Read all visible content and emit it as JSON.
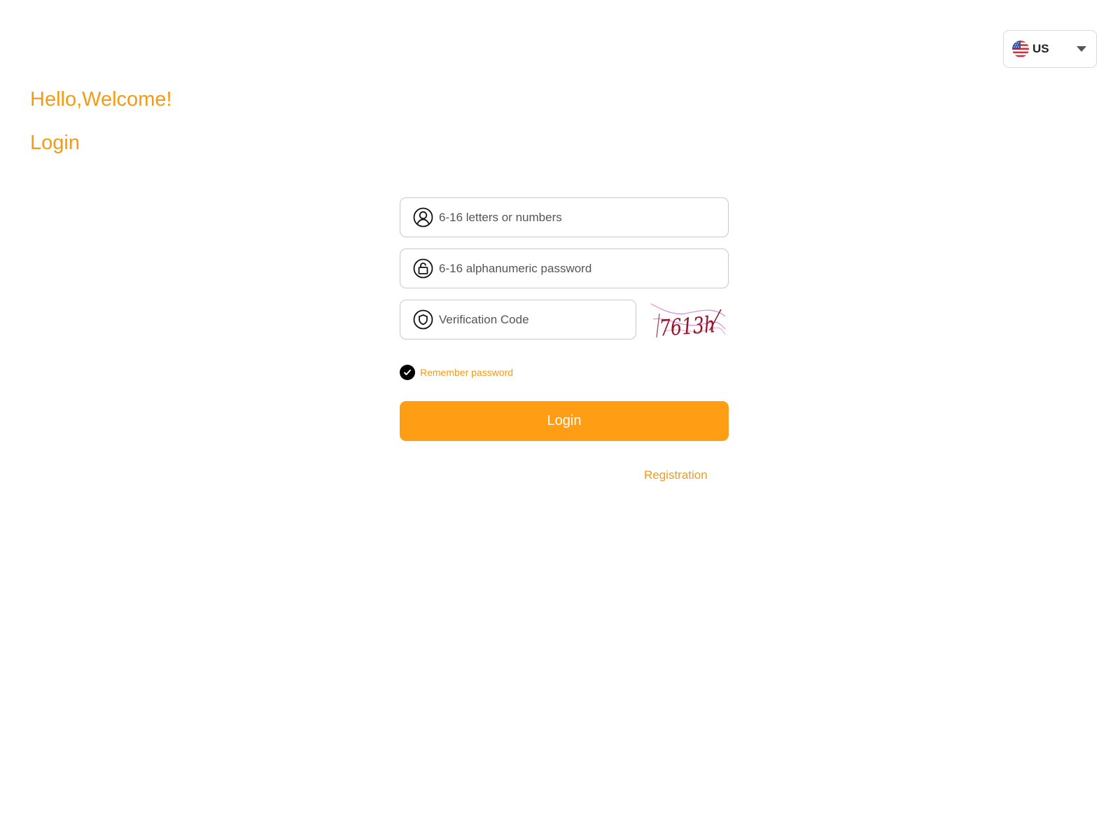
{
  "language": {
    "selected": "US",
    "flag_icon": "us-flag-icon"
  },
  "header": {
    "greeting": "Hello,Welcome!",
    "title": "Login"
  },
  "form": {
    "username": {
      "placeholder": "6-16 letters or numbers",
      "value": "",
      "icon": "user-icon"
    },
    "password": {
      "placeholder": "6-16 alphanumeric password",
      "value": "",
      "icon": "lock-icon"
    },
    "verification": {
      "placeholder": "Verification Code",
      "value": "",
      "icon": "shield-icon",
      "captcha_text": "7613h"
    },
    "remember": {
      "label": "Remember password",
      "checked": true
    },
    "submit_label": "Login",
    "register_label": "Registration"
  },
  "colors": {
    "accent": "#ff9e14",
    "accent_text": "#f79a13"
  }
}
